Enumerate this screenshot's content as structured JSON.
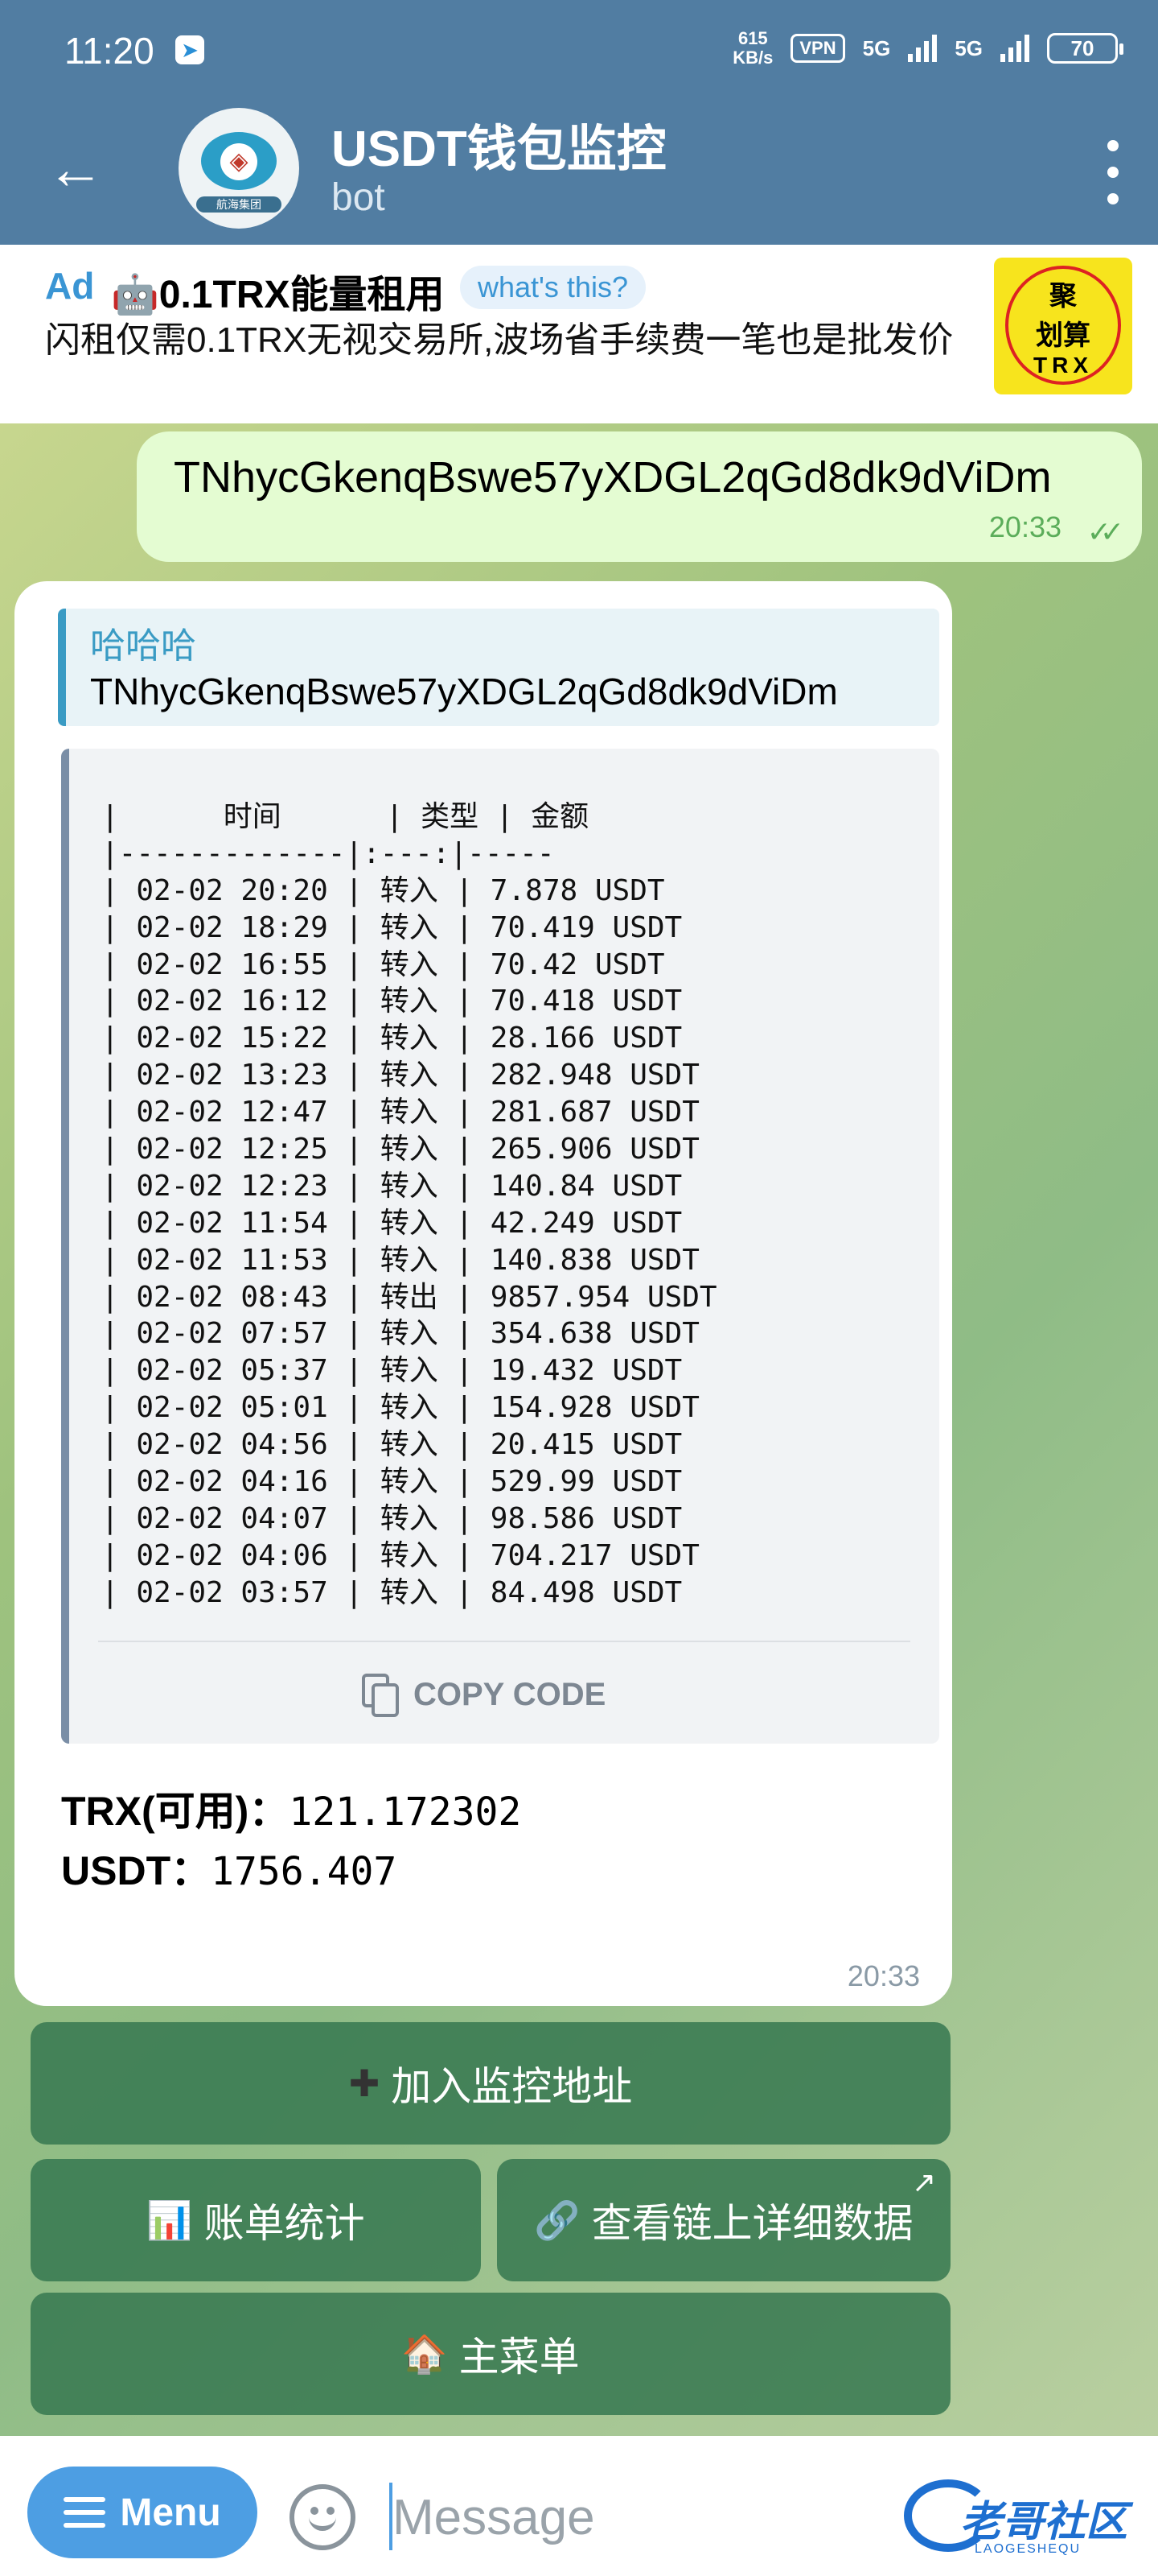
{
  "status_bar": {
    "time": "11:20",
    "speed_value": "615",
    "speed_unit": "KB/s",
    "vpn": "VPN",
    "net1": "5G",
    "net2": "5G",
    "battery": "70"
  },
  "header": {
    "title": "USDT钱包监控",
    "subtitle": "bot",
    "avatar_caption": "航海集团"
  },
  "ad": {
    "tag": "Ad",
    "title": "🤖0.1TRX能量租用",
    "whats_this": "what's this?",
    "text": "闪租仅需0.1TRX无视交易所,波场省手续费一笔也是批发价",
    "logo_top": "聚",
    "logo_mid": "划算",
    "logo_bottom": "TRX"
  },
  "outgoing": {
    "text": "TNhycGkenqBswe57yXDGL2qGd8dk9dViDm",
    "time": "20:33"
  },
  "incoming": {
    "quote_name": "哈哈哈",
    "quote_text": "TNhycGkenqBswe57yXDGL2qGd8dk9dViDm",
    "code_lines": [
      "|      时间      | 类型 | 金额",
      "|-------------|:---:|-----",
      "| 02-02 20:20 | 转入 | 7.878 USDT",
      "| 02-02 18:29 | 转入 | 70.419 USDT",
      "| 02-02 16:55 | 转入 | 70.42 USDT",
      "| 02-02 16:12 | 转入 | 70.418 USDT",
      "| 02-02 15:22 | 转入 | 28.166 USDT",
      "| 02-02 13:23 | 转入 | 282.948 USDT",
      "| 02-02 12:47 | 转入 | 281.687 USDT",
      "| 02-02 12:25 | 转入 | 265.906 USDT",
      "| 02-02 12:23 | 转入 | 140.84 USDT",
      "| 02-02 11:54 | 转入 | 42.249 USDT",
      "| 02-02 11:53 | 转入 | 140.838 USDT",
      "| 02-02 08:43 | 转出 | 9857.954 USDT",
      "| 02-02 07:57 | 转入 | 354.638 USDT",
      "| 02-02 05:37 | 转入 | 19.432 USDT",
      "| 02-02 05:01 | 转入 | 154.928 USDT",
      "| 02-02 04:56 | 转入 | 20.415 USDT",
      "| 02-02 04:16 | 转入 | 529.99 USDT",
      "| 02-02 04:07 | 转入 | 98.586 USDT",
      "| 02-02 04:06 | 转入 | 704.217 USDT",
      "| 02-02 03:57 | 转入 | 84.498 USDT"
    ],
    "copy_code": "COPY CODE",
    "trx_label": "TRX(可用)：",
    "trx_value": "121.172302",
    "usdt_label": "USDT：",
    "usdt_value": "1756.407",
    "time": "20:33"
  },
  "keyboard": {
    "add_monitor": "加入监控地址",
    "bill_stats": "账单统计",
    "chain_details": "查看链上详细数据",
    "main_menu": "主菜单"
  },
  "input_bar": {
    "menu": "Menu",
    "placeholder": "Message",
    "watermark": "老哥社区",
    "watermark_sub": "LAOGESHEQU"
  },
  "colors": {
    "header_bg": "#517da2",
    "outgoing_bubble": "#e4fcd2",
    "accent_blue": "#4d9ee3",
    "keyboard_button": "#3f8a5b"
  },
  "icons": {
    "back": "arrow-left-icon",
    "more": "more-vertical-icon",
    "copy": "copy-icon",
    "add": "plus-icon",
    "chart": "bar-chart-icon",
    "link": "link-icon",
    "home": "house-icon",
    "emoji": "smile-icon",
    "external": "external-link-icon"
  }
}
